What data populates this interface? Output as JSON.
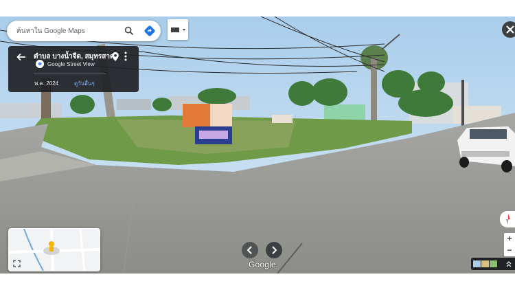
{
  "search": {
    "placeholder": "ค้นหาใน Google Maps"
  },
  "location": {
    "title": "ตำบล บางน้ำจืด, สมุทรสาคร",
    "source": "Google Street View",
    "date": "พ.ค. 2024",
    "more_label": "ดูวันอื่นๆ"
  },
  "watermark": "Google",
  "controls": {
    "zoom_in": "+",
    "zoom_out": "−"
  },
  "colors": {
    "panel": "#202124",
    "accent": "#1a73e8",
    "link": "#8ab4f8"
  }
}
